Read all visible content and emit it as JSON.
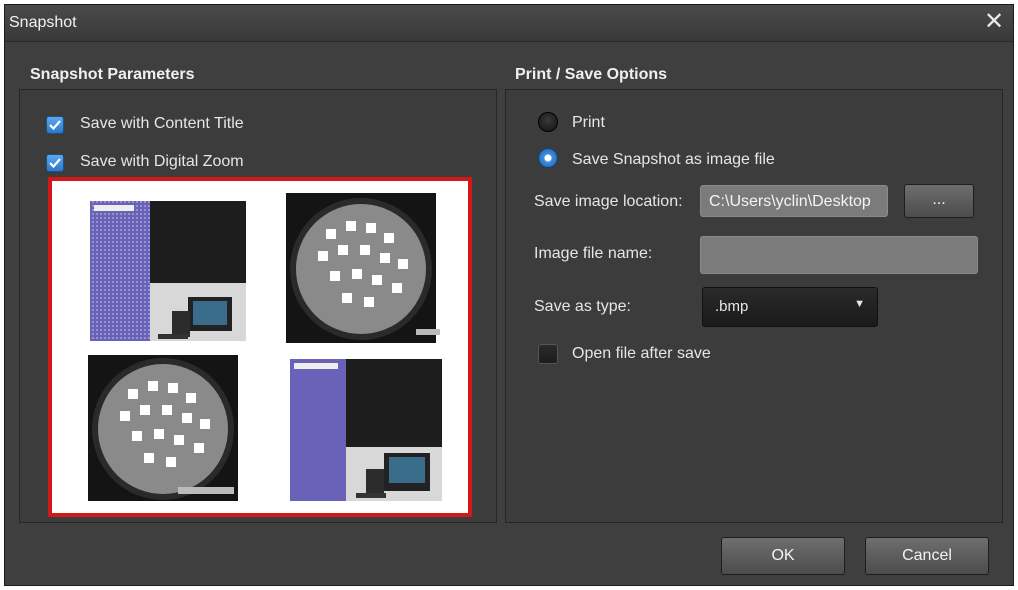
{
  "window": {
    "title": "Snapshot",
    "close_icon": "close-icon"
  },
  "left_section": {
    "title": "Snapshot Parameters",
    "options": [
      {
        "label": "Save with Content Title",
        "checked": true
      },
      {
        "label": "Save with Digital Zoom",
        "checked": true
      }
    ],
    "preview_border_color": "#d21818"
  },
  "right_section": {
    "title": "Print / Save Options",
    "radios": [
      {
        "label": "Print",
        "selected": false
      },
      {
        "label": "Save Snapshot as image file",
        "selected": true
      }
    ],
    "location_label": "Save image location:",
    "location_value": "C:\\Users\\yclin\\Desktop",
    "browse_label": "...",
    "filename_label": "Image file name:",
    "filename_value": "",
    "type_label": "Save as type:",
    "type_value": ".bmp",
    "open_after_label": "Open file after save",
    "open_after_checked": false
  },
  "buttons": {
    "ok": "OK",
    "cancel": "Cancel"
  }
}
